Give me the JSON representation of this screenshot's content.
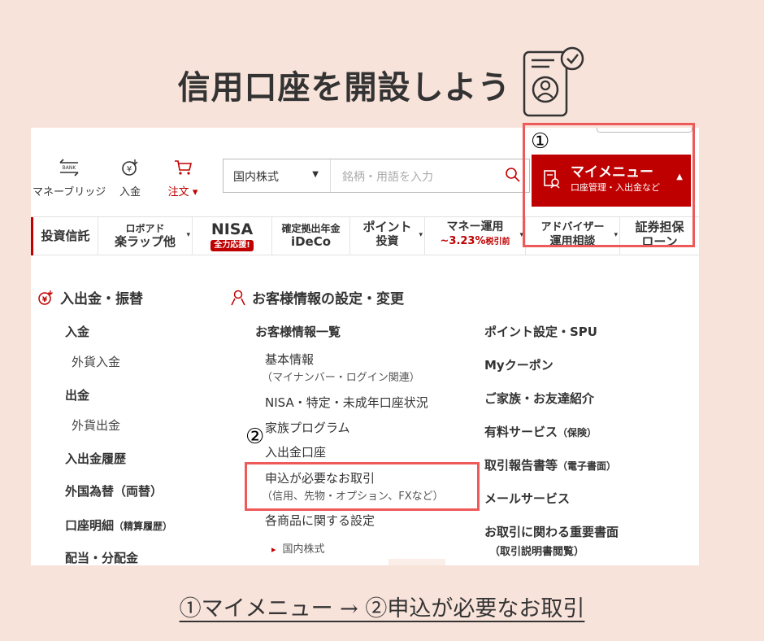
{
  "title": "信用口座を開設しよう",
  "header": {
    "money_bridge": "マネーブリッジ",
    "bank_tag": "BANK",
    "deposit": "入金",
    "orders": "注文",
    "order_caret": "▾",
    "search_select": "国内株式",
    "search_caret": "▼",
    "search_placeholder": "銘柄・用語を入力",
    "mymenu_title": "マイメニュー",
    "mymenu_sub": "口座管理・入出金など",
    "mymenu_caret": "▲"
  },
  "categories": {
    "tri": "▾",
    "toushin": "投資信託",
    "robo_l1": "ロボアド",
    "robo_l2": "楽ラップ他",
    "nisa": "NISA",
    "nisa_badge": "全力応援!",
    "ideco_l1": "確定拠出年金",
    "ideco_l2": "iDeCo",
    "point_l1": "ポイント",
    "point_l2": "投資",
    "money_l1": "マネー運用",
    "money_rate": "~3.23%",
    "money_tax": "税引前",
    "advisor_l1": "アドバイザー",
    "advisor_l2": "運用相談",
    "loan_l1": "証券担保",
    "loan_l2": "ローン"
  },
  "left_col": {
    "title": "入出金・振替",
    "items": [
      "入金",
      "外貨入金",
      "出金",
      "外貨出金",
      "入出金履歴",
      "外国為替（両替）",
      "口座明細",
      "配当・分配金"
    ],
    "meisai_small": "（精算履歴）"
  },
  "mid_col": {
    "title": "お客様情報の設定・変更",
    "list_title": "お客様情報一覧",
    "basic": "基本情報",
    "basic_sub": "（マイナンバー・ログイン関連）",
    "nisa": "NISA・特定・未成年口座状況",
    "family": "家族プログラム",
    "account": "入出金口座",
    "apply": "申込が必要なお取引",
    "apply_sub": "（信用、先物・オプション、FXなど）",
    "product": "各商品に関する設定",
    "domestic_bullet": "▸",
    "domestic": "国内株式"
  },
  "right_col": {
    "point": "ポイント設定・SPU",
    "coupon": "Myクーポン",
    "family": "ご家族・お友達紹介",
    "paid": "有料サービス",
    "paid_small": "（保険）",
    "report": "取引報告書等",
    "report_small": "（電子書面）",
    "mail": "メールサービス",
    "docs": "お取引に関わる重要書面",
    "docs_sub": "（取引説明書閲覧）"
  },
  "markers": {
    "one": "①",
    "two": "②"
  },
  "caption": "①マイメニュー → ②申込が必要なお取引",
  "colors": {
    "brand_red": "#bf0000",
    "highlight": "#ee5959",
    "background": "#f8e3da"
  }
}
